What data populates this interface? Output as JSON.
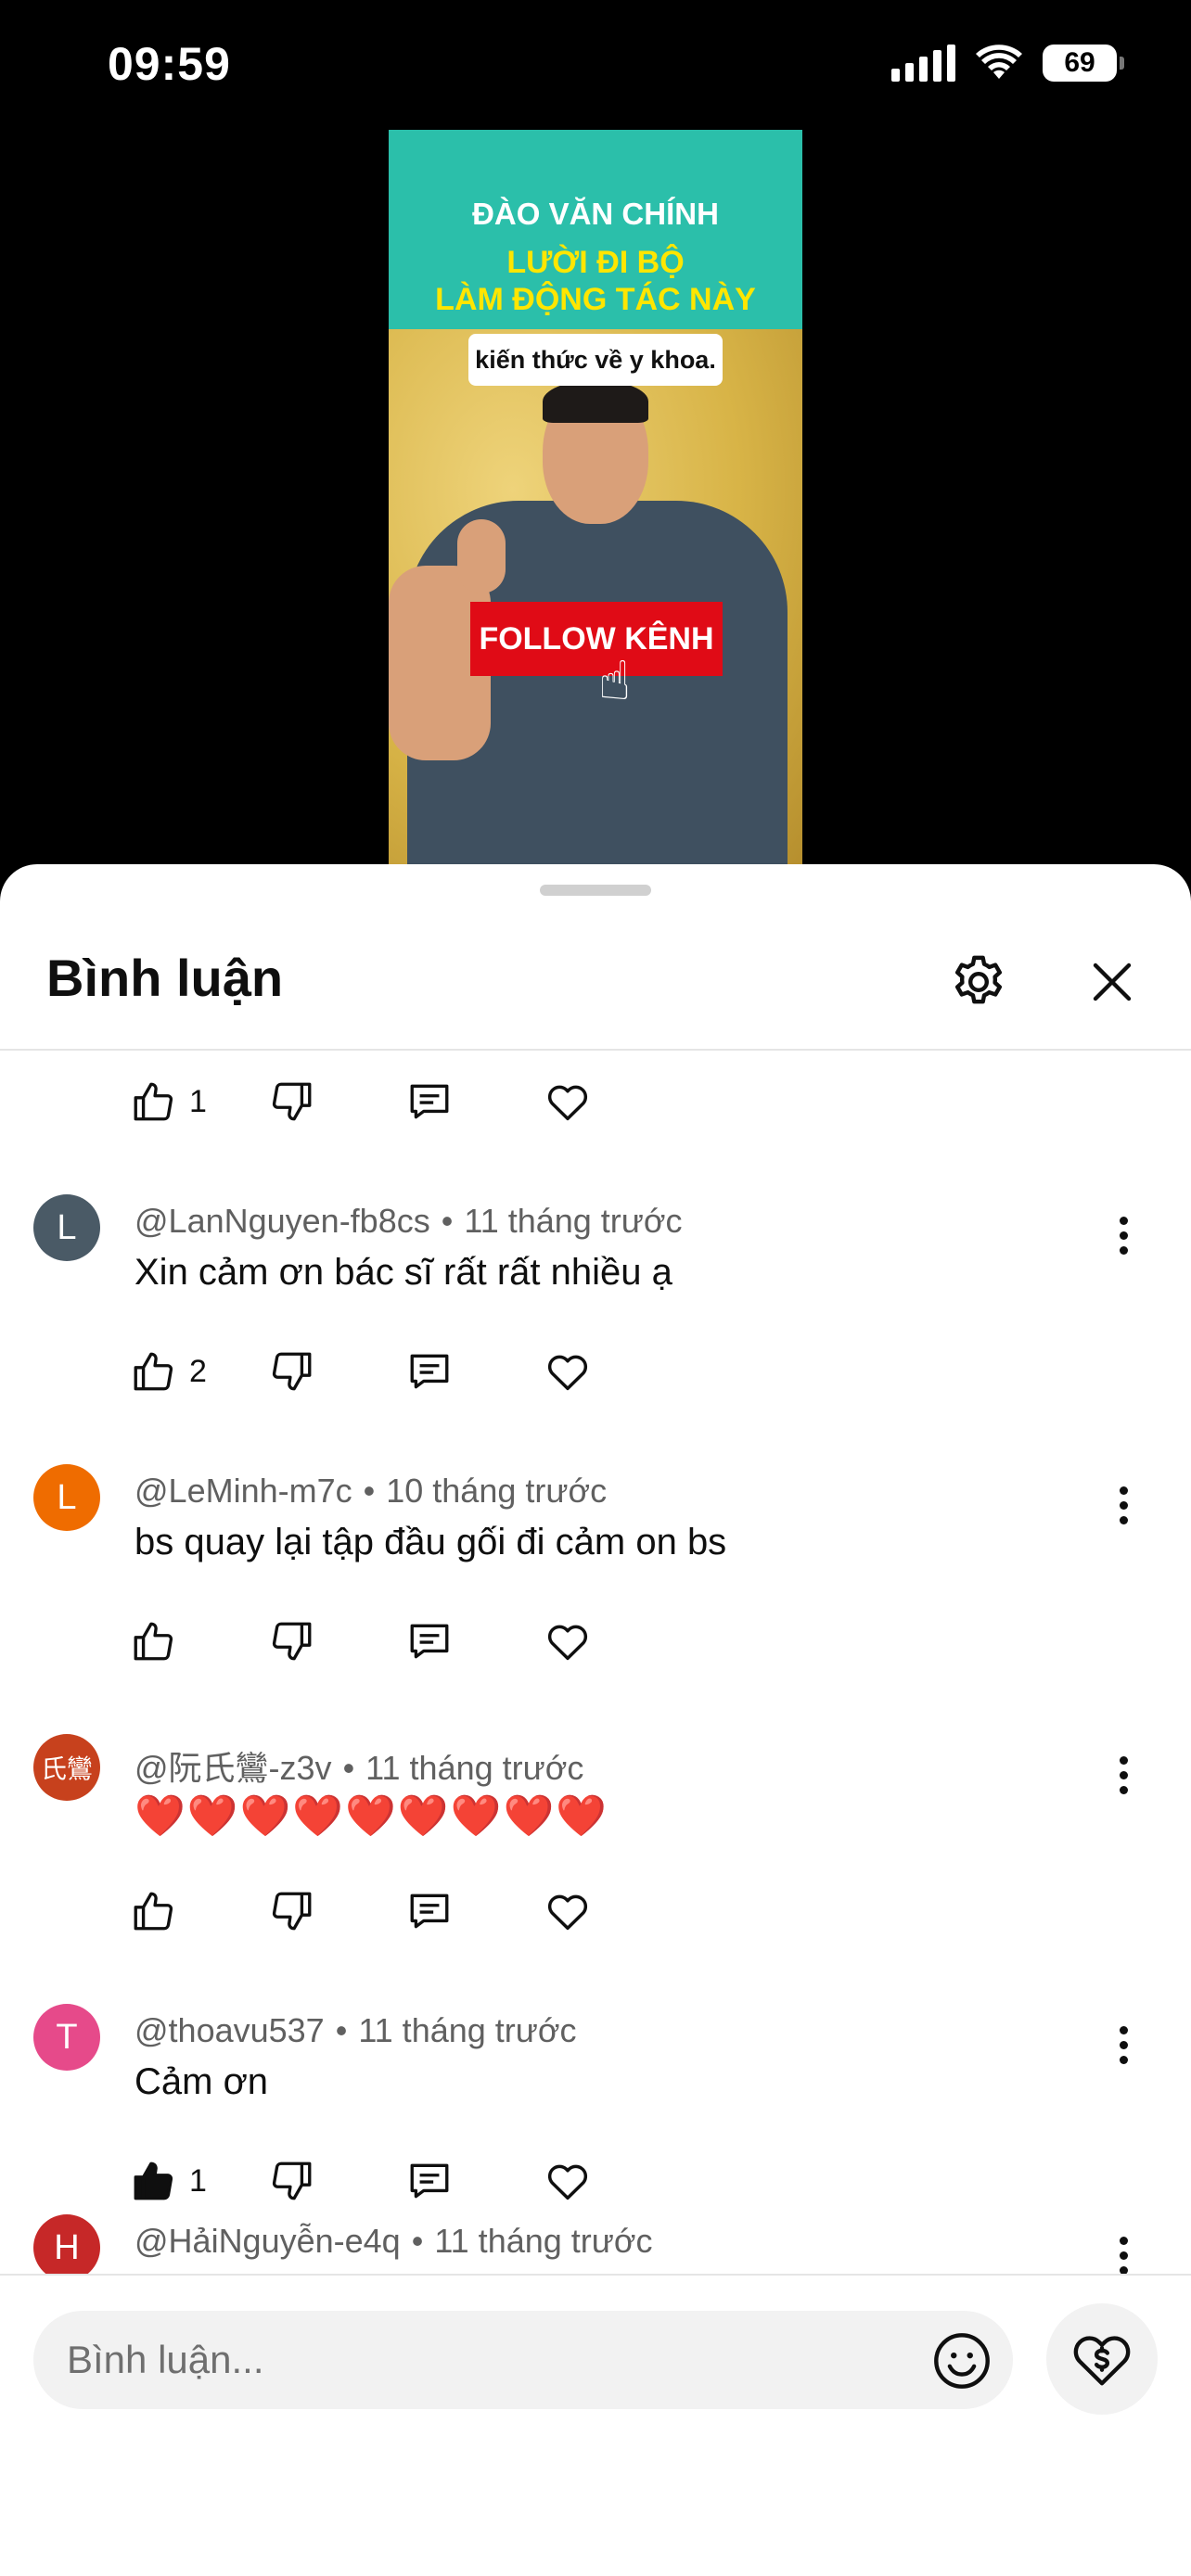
{
  "status_bar": {
    "time": "09:59",
    "battery": "69"
  },
  "video": {
    "name": "ĐÀO VĂN CHÍNH",
    "headline_line1": "LƯỜI ĐI BỘ",
    "headline_line2": "LÀM ĐỘNG TÁC NÀY",
    "subtitle": "kiến thức về y khoa.",
    "follow_label": "FOLLOW KÊNH"
  },
  "sheet": {
    "title": "Bình luận",
    "settings_icon": "gear-icon",
    "close_icon": "close-icon"
  },
  "comments": [
    {
      "author": "",
      "time": "",
      "text": "",
      "likes": "1",
      "liked": false
    },
    {
      "initial": "L",
      "avatar_color": "#4a5a66",
      "author": "@LanNguyen-fb8cs",
      "time": "11 tháng trước",
      "text": "Xin cảm ơn bác sĩ rất rất nhiều ạ",
      "likes": "2",
      "liked": false
    },
    {
      "initial": "L",
      "avatar_color": "#ef6c00",
      "author": "@LeMinh-m7c",
      "time": "10 tháng trước",
      "text": "bs quay lại tập đầu gối đi cảm on bs",
      "likes": "",
      "liked": false
    },
    {
      "initial": "氏鸞",
      "avatar_color": "#c7411d",
      "author": "@阮氏鸞-z3v",
      "time": "11 tháng trước",
      "text": "❤️❤️❤️❤️❤️❤️❤️❤️❤️",
      "likes": "",
      "liked": false
    },
    {
      "initial": "T",
      "avatar_color": "#e64a8a",
      "author": "@thoavu537",
      "time": "11 tháng trước",
      "text": "Cảm ơn",
      "likes": "1",
      "liked": true
    },
    {
      "initial": "H",
      "avatar_color": "#c62828",
      "author": "@HảiNguyễn-e4q",
      "time": "11 tháng trước",
      "text": "",
      "likes": "",
      "liked": false
    }
  ],
  "meta_separator": "•",
  "input": {
    "placeholder": "Bình luận..."
  },
  "icons": {
    "like": "thumbs-up-icon",
    "dislike": "thumbs-down-icon",
    "reply": "reply-icon",
    "heart": "heart-icon",
    "emoji": "emoji-icon",
    "thanks": "super-thanks-icon"
  }
}
